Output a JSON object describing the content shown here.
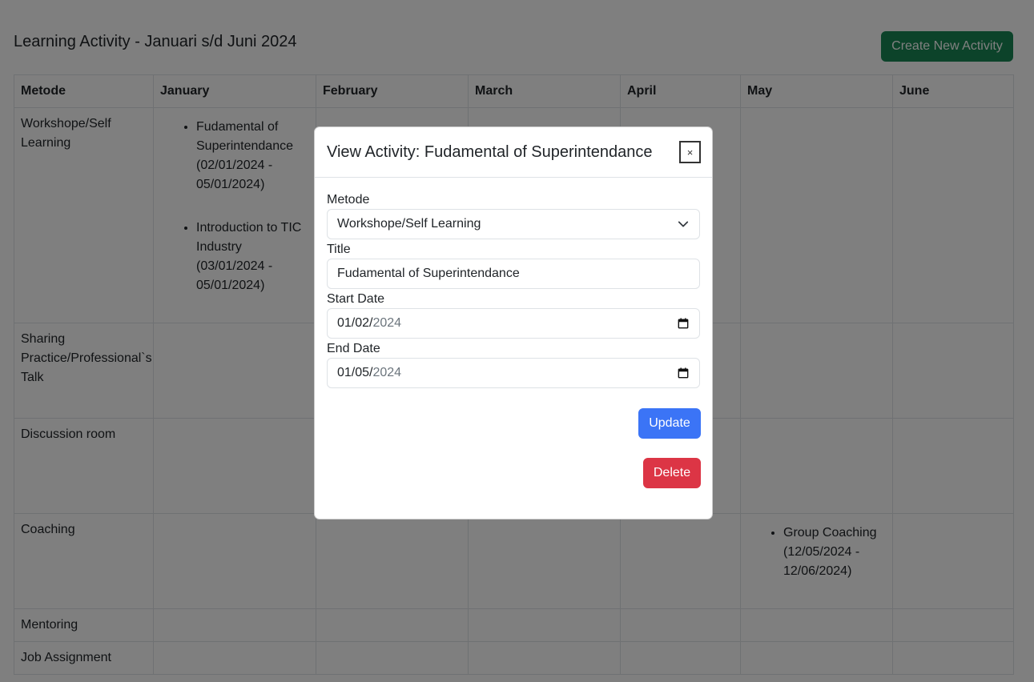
{
  "page": {
    "title": "Learning Activity - Januari s/d Juni 2024",
    "create_button": "Create New Activity"
  },
  "table": {
    "headers": [
      "Metode",
      "January",
      "February",
      "March",
      "April",
      "May",
      "June"
    ],
    "rows": [
      {
        "metode": "Workshope/Self Learning",
        "january": [
          "Fudamental of Superintendance (02/01/2024 - 05/01/2024)",
          "Introduction to TIC Industry (03/01/2024 - 05/01/2024)"
        ]
      },
      {
        "metode": "Sharing Practice/Professional`s Talk"
      },
      {
        "metode": "Discussion room"
      },
      {
        "metode": "Coaching",
        "may": [
          "Group Coaching (12/05/2024 - 12/06/2024)"
        ]
      },
      {
        "metode": "Mentoring"
      },
      {
        "metode": "Job Assignment"
      }
    ]
  },
  "modal": {
    "title": "View Activity: Fudamental of Superintendance",
    "close_label": "×",
    "fields": {
      "metode": {
        "label": "Metode",
        "value": "Workshope/Self Learning"
      },
      "title": {
        "label": "Title",
        "value": "Fudamental of Superintendance"
      },
      "start_date": {
        "label": "Start Date",
        "mmdd": "01/02/",
        "yyyy": "2024"
      },
      "end_date": {
        "label": "End Date",
        "mmdd": "01/05/",
        "yyyy": "2024"
      }
    },
    "update_button": "Update",
    "delete_button": "Delete"
  },
  "icons": {
    "select": "chevron-down-icon",
    "date": "calendar-icon"
  },
  "colors": {
    "success": "#198754",
    "primary": "#3b74f6",
    "danger": "#dc3545",
    "backdrop": "rgba(0,0,0,0.5)"
  }
}
